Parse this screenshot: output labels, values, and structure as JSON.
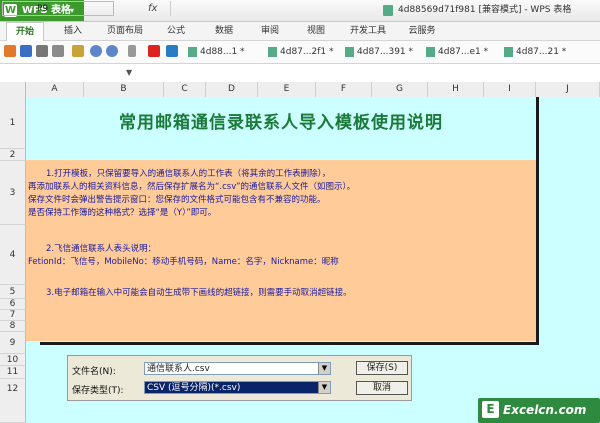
{
  "app": {
    "name": "WPS 表格",
    "caret": "▾"
  },
  "window": {
    "title": "4d88569d71f981 [兼容模式] - WPS 表格"
  },
  "tabs": [
    "开始",
    "插入",
    "页面布局",
    "公式",
    "数据",
    "审阅",
    "视图",
    "开发工具",
    "云服务"
  ],
  "doc_tabs": [
    "4d88...1 *",
    "4d87...2f1 *",
    "4d87...391 *",
    "4d87...e1 *",
    "4d87...21 *"
  ],
  "formula": {
    "cell_ref": "P9",
    "fx": "fx",
    "value": ""
  },
  "columns": [
    "A",
    "B",
    "C",
    "D",
    "E",
    "F",
    "G",
    "H",
    "I",
    "J"
  ],
  "rows": [
    "1",
    "2",
    "3",
    "4",
    "5",
    "6",
    "7",
    "8",
    "9",
    "10",
    "11",
    "12"
  ],
  "sheet": {
    "title": "常用邮箱通信录联系人导入模板使用说明",
    "lines": [
      "1.打开模板，只保留要导入的通信联系人的工作表（将其余的工作表删除），",
      "再添加联系人的相关资料信息，然后保存扩展名为“.csv”的通信联系人文件（如图示）。",
      "保存文件时会弹出警告提示窗口：您保存的文件格式可能包含有不兼容的功能。",
      "是否保持工作簿的这种格式？选择“是（Y）”即可。",
      "2.飞信通信联系人表头说明：",
      "FetionId：飞信号，MobileNo：移动手机号码，Name：名字，Nickname：昵称",
      "3.电子邮箱在输入中可能会自动生成带下画线的超链接，则需要手动取消超链接。"
    ]
  },
  "dialog": {
    "filename_label": "文件名(N):",
    "filename_value": "通信联系人.csv",
    "filetype_label": "保存类型(T):",
    "filetype_value": "CSV (逗号分隔)(*.csv)",
    "save_label": "保存(S)",
    "cancel_label": "取消"
  },
  "watermark": {
    "text": "Excelcn.com",
    "logo": "E"
  },
  "colors": {
    "sheet_bg": "#ccffff",
    "panel_bg": "#ffcc99",
    "title": "#1a7a3a",
    "text": "#1a1aa0",
    "accent": "#3c9a2c"
  }
}
